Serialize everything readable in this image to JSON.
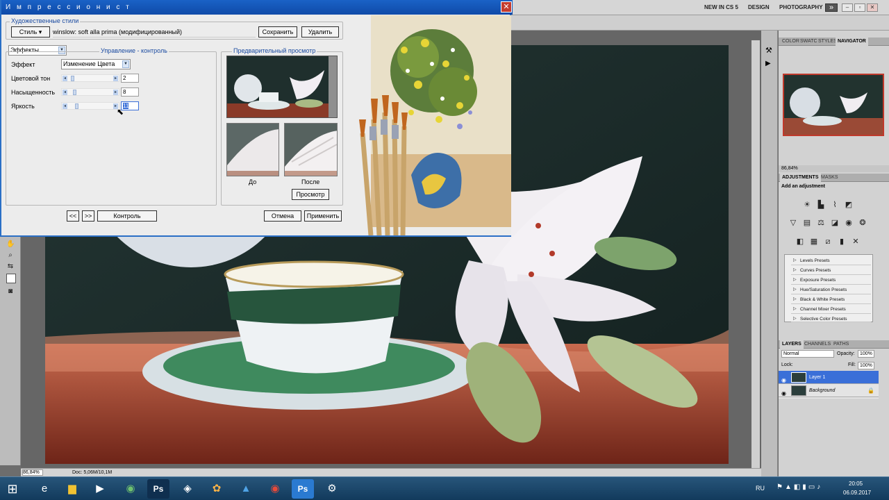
{
  "dialog": {
    "title": "И м п р е с с и о н и с т",
    "close_label": "✕",
    "styles_group_label": "Художественные стили",
    "style_button": "Стиль ▾",
    "style_name_value": "winslow: soft alla prima (модифицированный)",
    "save_button": "Сохранить",
    "delete_button": "Удалить",
    "mode_select": "Эффекты",
    "control_group_label": "Управление - контроль",
    "effect_label": "Эффект",
    "effect_value": "Изменение Цвета",
    "params": [
      {
        "label": "Цветовой тон",
        "value": "2",
        "level": 0.1
      },
      {
        "label": "Насыщенность",
        "value": "8",
        "level": 0.15
      },
      {
        "label": "Яркость",
        "value": "11",
        "level": 0.2
      }
    ],
    "preview_group_label": "Предварительный просмотр",
    "before_label": "До",
    "after_label": "После",
    "preview_button": "Просмотр",
    "prev_button": "<<",
    "next_button": ">>",
    "control_button": "Контроль",
    "cancel_button": "Отмена",
    "apply_button": "Применить"
  },
  "appbar": {
    "workspaces": [
      "NEW IN CS 5",
      "DESIGN",
      "PHOTOGRAPHY"
    ],
    "more_label": "»"
  },
  "navigator": {
    "tabs": [
      "COLOR",
      "SWATC",
      "STYLES",
      "NAVIGATOR"
    ],
    "zoom": "86,84%"
  },
  "adjustments": {
    "tabs": [
      "ADJUSTMENTS",
      "MASKS"
    ],
    "heading": "Add an adjustment",
    "presets": [
      "Levels Presets",
      "Curves Presets",
      "Exposure Presets",
      "Hue/Saturation Presets",
      "Black & White Presets",
      "Channel Mixer Presets",
      "Selective Color Presets"
    ]
  },
  "layers": {
    "tabs": [
      "LAYERS",
      "CHANNELS",
      "PATHS"
    ],
    "blend_mode": "Normal",
    "opacity_label": "Opacity:",
    "opacity_value": "100%",
    "lock_label": "Lock:",
    "fill_label": "Fill:",
    "fill_value": "100%",
    "items": [
      {
        "name": "Layer 1",
        "selected": true
      },
      {
        "name": "Background",
        "selected": false
      }
    ]
  },
  "status": {
    "zoom": "86,84%",
    "doc": "Doc: 5,06M/10,1M"
  },
  "taskbar": {
    "lang": "RU",
    "time": "20:05",
    "date": "06.09.2017"
  },
  "colors": {
    "title_bar": "#1a62c6",
    "accent_blue": "#2a6fc6",
    "layer_selected": "#3a6fd8",
    "close_red": "#c43c2e"
  }
}
